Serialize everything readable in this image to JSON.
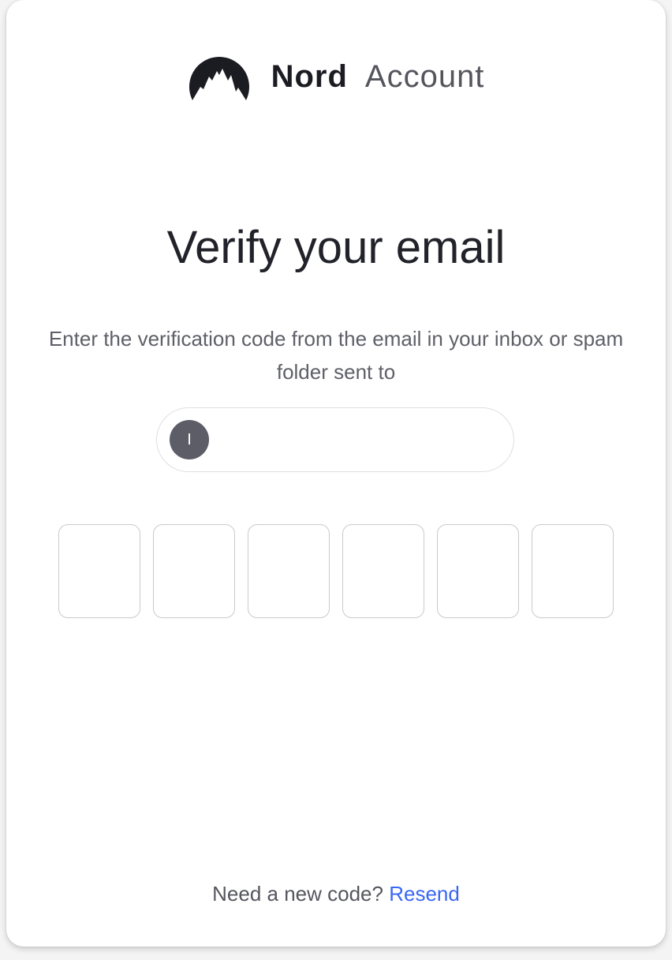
{
  "brand": {
    "name_bold": "Nord",
    "name_light": "Account",
    "logo_icon": "nord-mountain-icon"
  },
  "title": "Verify your email",
  "subtitle": "Enter the verification code from the email in your inbox or spam folder sent to",
  "email": {
    "avatar_initial": "I",
    "address": ""
  },
  "code": {
    "digits": [
      "",
      "",
      "",
      "",
      "",
      ""
    ]
  },
  "resend": {
    "prompt": "Need a new code?",
    "link_label": "Resend"
  },
  "colors": {
    "link": "#3b67f5",
    "title": "#22232a",
    "avatar_bg": "#5c5d66"
  }
}
